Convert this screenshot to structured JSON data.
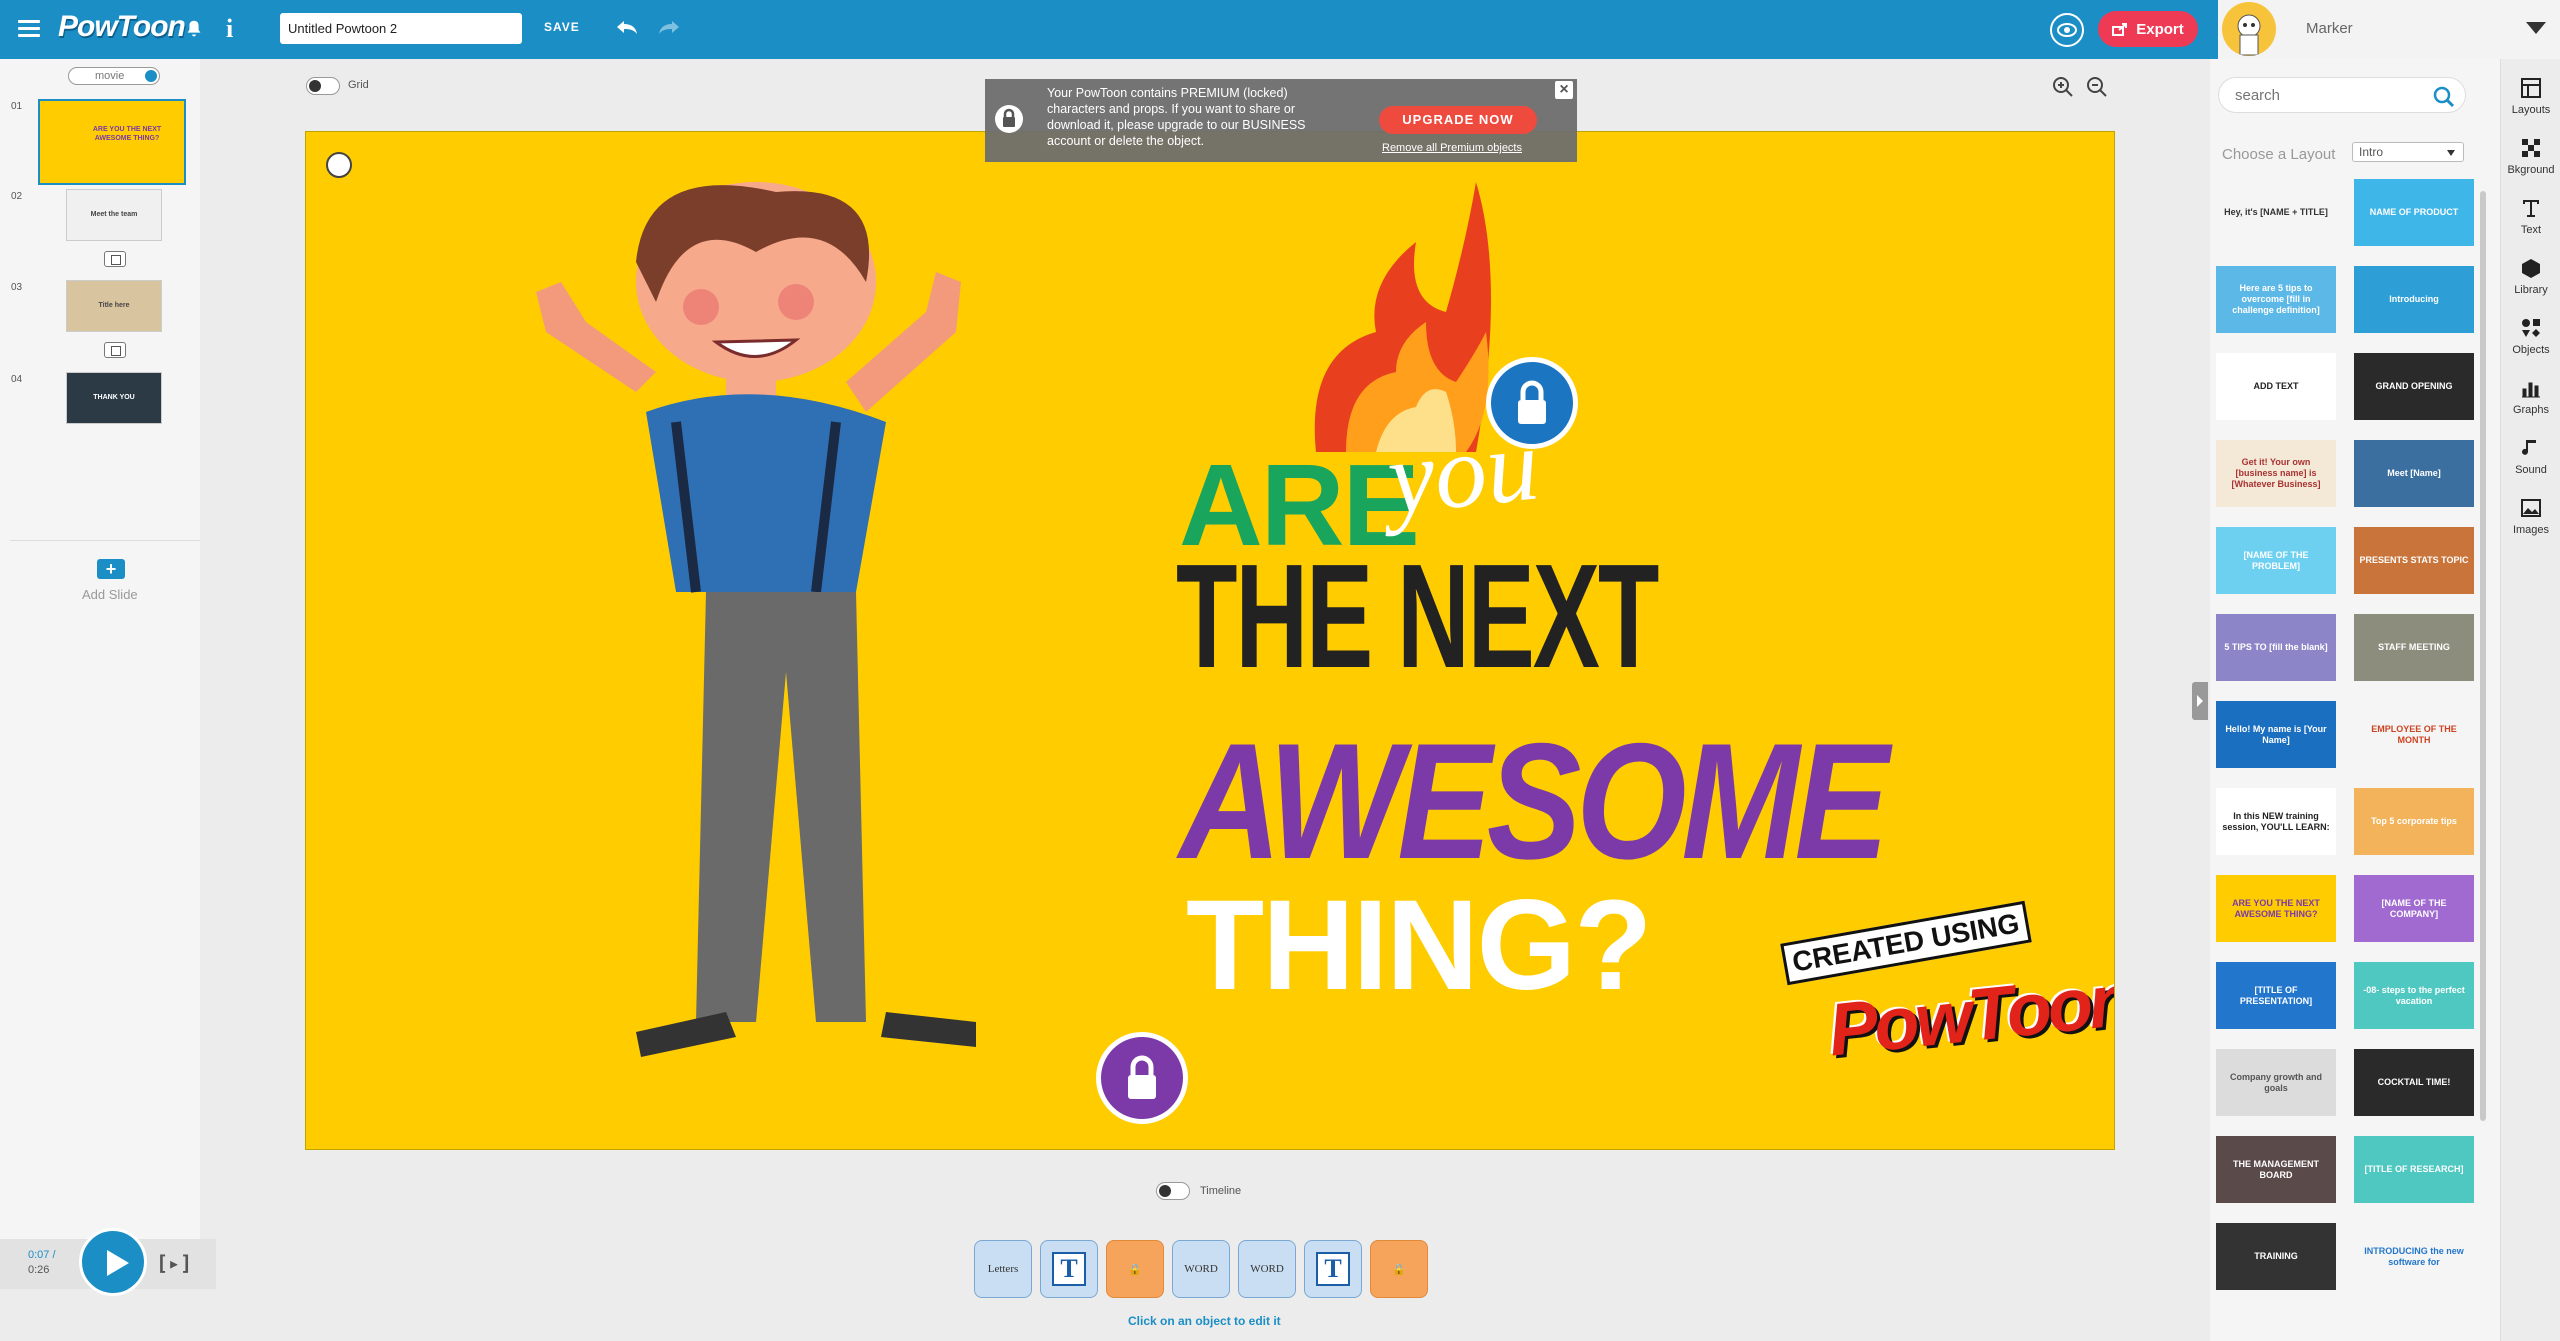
{
  "app": {
    "logo_text": "PowToon",
    "project_title": "Untitled Powtoon 2",
    "save_label": "SAVE",
    "export_label": "Export"
  },
  "user": {
    "name": "Marker"
  },
  "slides_panel": {
    "movie_label": "movie",
    "slides": [
      {
        "number": "01",
        "bg": "#ffcc00",
        "caption": "ARE YOU THE NEXT AWESOME THING?"
      },
      {
        "number": "02",
        "bg": "#f0f0f0",
        "caption": "Meet the team"
      },
      {
        "number": "03",
        "bg": "#d9c4a0",
        "caption": "Title here"
      },
      {
        "number": "04",
        "bg": "#2b3a45",
        "caption": "THANK YOU"
      }
    ],
    "add_slide_label": "Add Slide"
  },
  "player": {
    "time_current": "0:07 /",
    "time_total": "0:26"
  },
  "canvas_tools": {
    "grid_label": "Grid",
    "timeline_label": "Timeline"
  },
  "premium_popup": {
    "message": "Your PowToon contains PREMIUM (locked) characters and props. If you want to share or download it, please upgrade to our BUSINESS account or delete the object.",
    "upgrade_label": "UPGRADE NOW",
    "remove_link": "Remove all Premium objects",
    "close_label": "×"
  },
  "stage": {
    "line_are": "ARE",
    "line_you": "you",
    "line_next": "THE NEXT",
    "line_awesome": "AWESOME",
    "line_thing": "THING?",
    "stamp_created": "CREATED USING",
    "stamp_brand": "PowToon"
  },
  "objects_strip": {
    "items": [
      {
        "label": "Letters",
        "locked": false
      },
      {
        "label": "T",
        "locked": false
      },
      {
        "label": "🔒",
        "locked": true
      },
      {
        "label": "WORD",
        "locked": false
      },
      {
        "label": "WORD",
        "locked": false
      },
      {
        "label": "T",
        "locked": false
      },
      {
        "label": "🔒",
        "locked": true
      }
    ],
    "hint": "Click on an object to edit it"
  },
  "right_panel": {
    "search_placeholder": "search",
    "choose_layout_label": "Choose a Layout",
    "layout_selected": "Intro",
    "layouts": [
      {
        "bg": "#f5f5f5",
        "fg": "#333",
        "text": "Hey, it's [NAME + TITLE]"
      },
      {
        "bg": "#3fb6e8",
        "fg": "#fff",
        "text": "NAME OF PRODUCT"
      },
      {
        "bg": "#5cb8e6",
        "fg": "#fff",
        "text": "Here are 5 tips to overcome [fill in challenge definition]"
      },
      {
        "bg": "#2d9fd6",
        "fg": "#fff",
        "text": "Introducing"
      },
      {
        "bg": "#ffffff",
        "fg": "#222",
        "text": "ADD TEXT"
      },
      {
        "bg": "#2a2a2a",
        "fg": "#fff",
        "text": "GRAND OPENING"
      },
      {
        "bg": "#f3e9d6",
        "fg": "#a33",
        "text": "Get it! Your own [business name] is [Whatever Business]"
      },
      {
        "bg": "#3b6fa0",
        "fg": "#fff",
        "text": "Meet [Name]"
      },
      {
        "bg": "#6dd0f0",
        "fg": "#fff",
        "text": "[NAME OF THE PROBLEM]"
      },
      {
        "bg": "#c9743a",
        "fg": "#fff",
        "text": "PRESENTS STATS TOPIC"
      },
      {
        "bg": "#8c86c8",
        "fg": "#fff",
        "text": "5 TIPS TO [fill the blank]"
      },
      {
        "bg": "#8d8d7e",
        "fg": "#fff",
        "text": "STAFF MEETING"
      },
      {
        "bg": "#1b6fc0",
        "fg": "#fff",
        "text": "Hello! My name is [Your Name]"
      },
      {
        "bg": "#f5f5f5",
        "fg": "#c42",
        "text": "EMPLOYEE OF THE MONTH"
      },
      {
        "bg": "#ffffff",
        "fg": "#222",
        "text": "In this NEW training session, YOU'LL LEARN:"
      },
      {
        "bg": "#f2b35a",
        "fg": "#fff",
        "text": "Top 5 corporate tips"
      },
      {
        "bg": "#ffcc00",
        "fg": "#7b3aa8",
        "text": "ARE YOU THE NEXT AWESOME THING?"
      },
      {
        "bg": "#a06ad0",
        "fg": "#fff",
        "text": "[NAME OF THE COMPANY]"
      },
      {
        "bg": "#2277cc",
        "fg": "#fff",
        "text": "[TITLE OF PRESENTATION]"
      },
      {
        "bg": "#4ec8c0",
        "fg": "#fff",
        "text": "-08- steps to the perfect vacation"
      },
      {
        "bg": "#dcdcdc",
        "fg": "#555",
        "text": "Company growth and goals"
      },
      {
        "bg": "#2a2a2a",
        "fg": "#fff",
        "text": "COCKTAIL TIME!"
      },
      {
        "bg": "#5a4a4a",
        "fg": "#fff",
        "text": "THE MANAGEMENT BOARD"
      },
      {
        "bg": "#4ec8c0",
        "fg": "#fff",
        "text": "[TITLE OF RESEARCH]"
      },
      {
        "bg": "#333333",
        "fg": "#fff",
        "text": "TRAINING"
      },
      {
        "bg": "#f5f5f5",
        "fg": "#2277cc",
        "text": "INTRODUCING the new software for"
      }
    ]
  },
  "tool_rail": {
    "tools": [
      {
        "label": "Layouts",
        "icon": "layouts-icon"
      },
      {
        "label": "Bkground",
        "icon": "background-icon"
      },
      {
        "label": "Text",
        "icon": "text-icon"
      },
      {
        "label": "Library",
        "icon": "library-icon"
      },
      {
        "label": "Objects",
        "icon": "objects-icon"
      },
      {
        "label": "Graphs",
        "icon": "graphs-icon"
      },
      {
        "label": "Sound",
        "icon": "sound-icon"
      },
      {
        "label": "Images",
        "icon": "images-icon"
      }
    ]
  },
  "colors": {
    "brand_blue": "#1b8ec6",
    "export_red": "#ef3a56",
    "stage_yellow": "#ffcc00",
    "awesome_purple": "#7b3aa8",
    "are_green": "#1aa55c",
    "lock_blue": "#1c75c0",
    "lock_purple": "#7b3aa8"
  }
}
